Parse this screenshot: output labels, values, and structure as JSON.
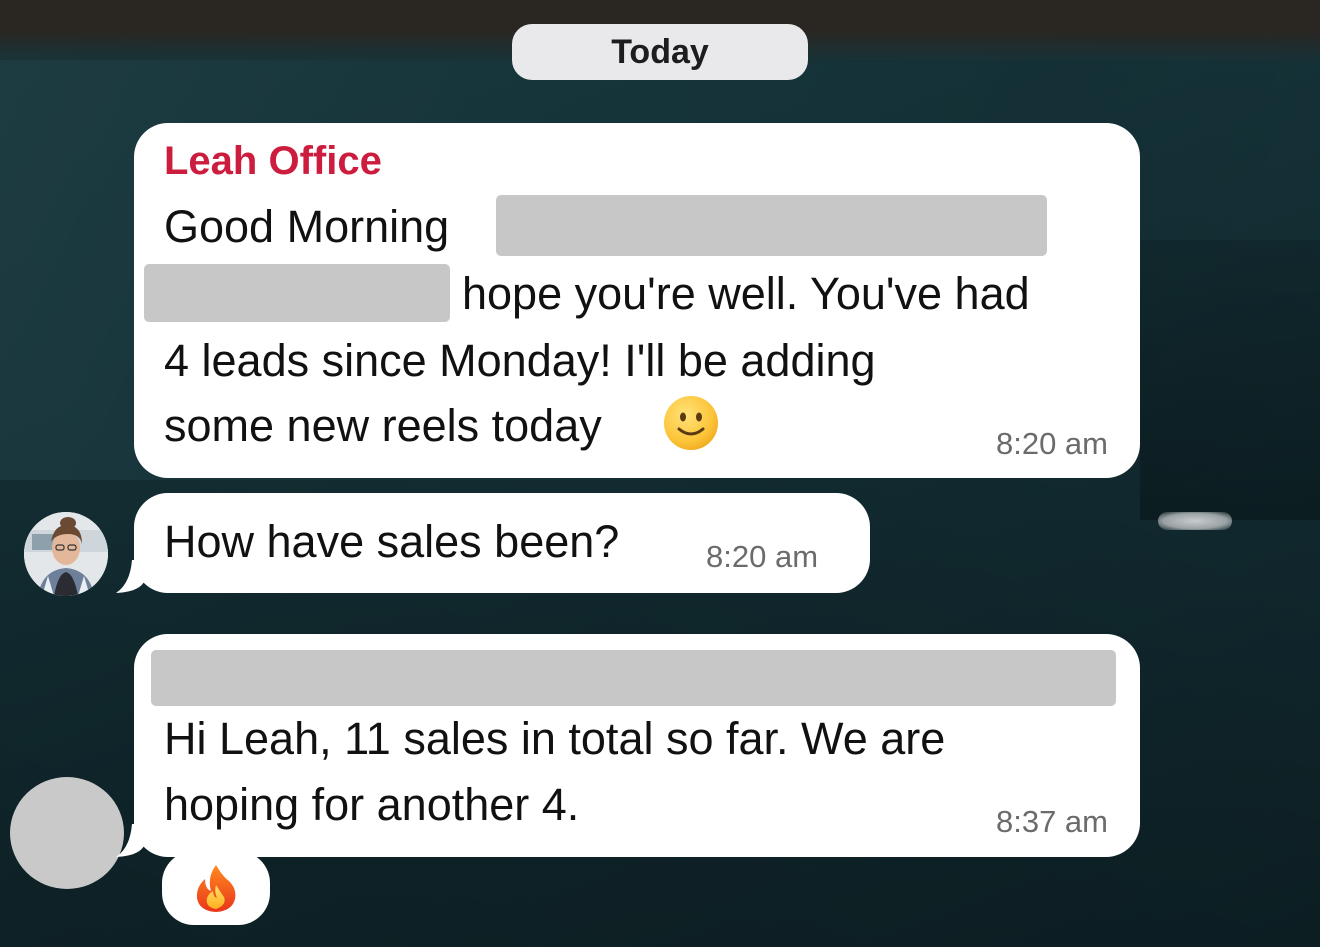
{
  "date_separator": "Today",
  "colors": {
    "sender_name": "#cc1d3f",
    "bubble": "#ffffff",
    "redaction": "#c7c7c7",
    "timestamp": "#6b6b6b",
    "date_pill": "#e9e9eb"
  },
  "messages": [
    {
      "sender": "Leah Office",
      "lines": [
        "Good Morning",
        "hope you're well. You've had",
        "4 leads since Monday! I'll be adding",
        "some new reels today"
      ],
      "emoji": "slightly-smiling-face-icon",
      "time": "8:20 am",
      "redacted": true
    },
    {
      "lines": [
        "How have sales been?"
      ],
      "time": "8:20 am",
      "avatar": "profile-photo"
    },
    {
      "lines": [
        "Hi Leah, 11 sales in total so far. We are",
        "hoping for another 4."
      ],
      "time": "8:37 am",
      "redacted_header": true,
      "avatar": "redacted-avatar",
      "reaction": "fire-icon"
    }
  ]
}
